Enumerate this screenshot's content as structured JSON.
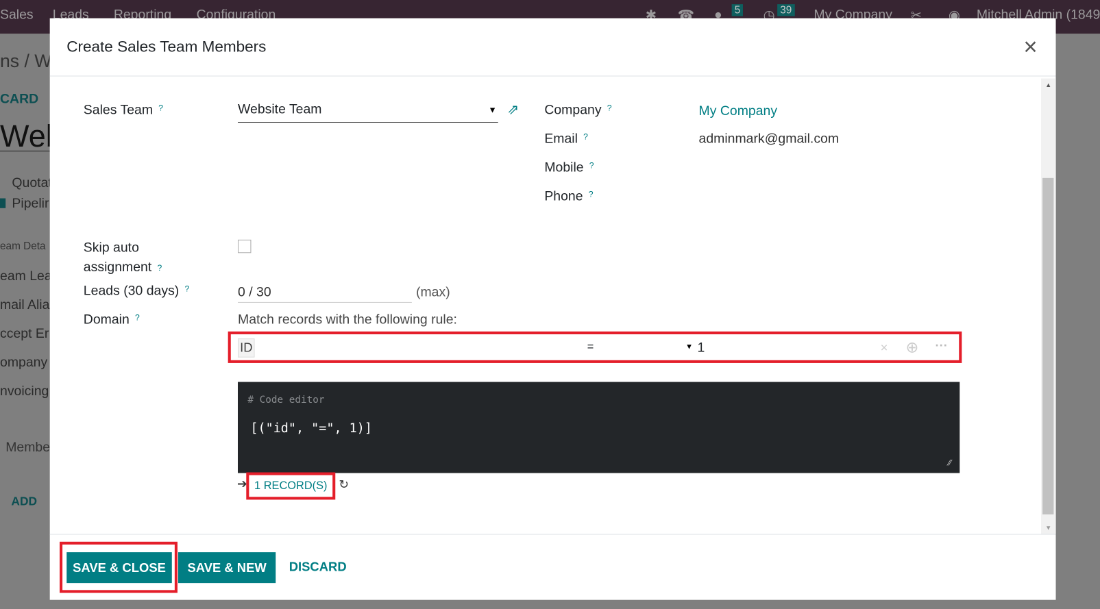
{
  "navbar": {
    "menu": [
      "Sales",
      "Leads",
      "Reporting",
      "Configuration"
    ],
    "messages_count": "5",
    "activities_count": "39",
    "company": "My Company",
    "user": "Mitchell Admin (1849"
  },
  "background": {
    "breadcrumb": "ns / W",
    "discard": "CARD",
    "record_title": "Web",
    "checkbox_quotations": "Quotat",
    "checkbox_pipeline": "Pipelir",
    "section": "eam Deta",
    "fields": [
      "eam Lea",
      "mail Alia",
      "ccept Er",
      "ompany",
      "nvoicing"
    ],
    "members_tab": "Membe",
    "add": "ADD"
  },
  "dialog": {
    "title": "Create Sales Team Members",
    "fields": {
      "sales_team_label": "Sales Team",
      "sales_team_value": "Website Team",
      "company_label": "Company",
      "company_value": "My Company",
      "email_label": "Email",
      "email_value": "adminmark@gmail.com",
      "mobile_label": "Mobile",
      "phone_label": "Phone",
      "skip_label_1": "Skip auto",
      "skip_label_2": "assignment",
      "leads_label": "Leads (30 days)",
      "leads_value": "0 / 30",
      "leads_suffix": "(max)",
      "domain_label": "Domain",
      "domain_intro": "Match records with the following rule:",
      "rule_field": "ID",
      "rule_operator": "=",
      "rule_value": "1",
      "code_comment": "# Code editor",
      "code_value": "[(\"id\", \"=\", 1)]",
      "records": "1 RECORD(S)"
    },
    "help_mark": "?",
    "buttons": {
      "save_close": "SAVE & CLOSE",
      "save_new": "SAVE & NEW",
      "discard": "DISCARD"
    }
  },
  "colors": {
    "accent": "#017e84",
    "highlight": "#e41e2a",
    "navbar": "#372532"
  }
}
